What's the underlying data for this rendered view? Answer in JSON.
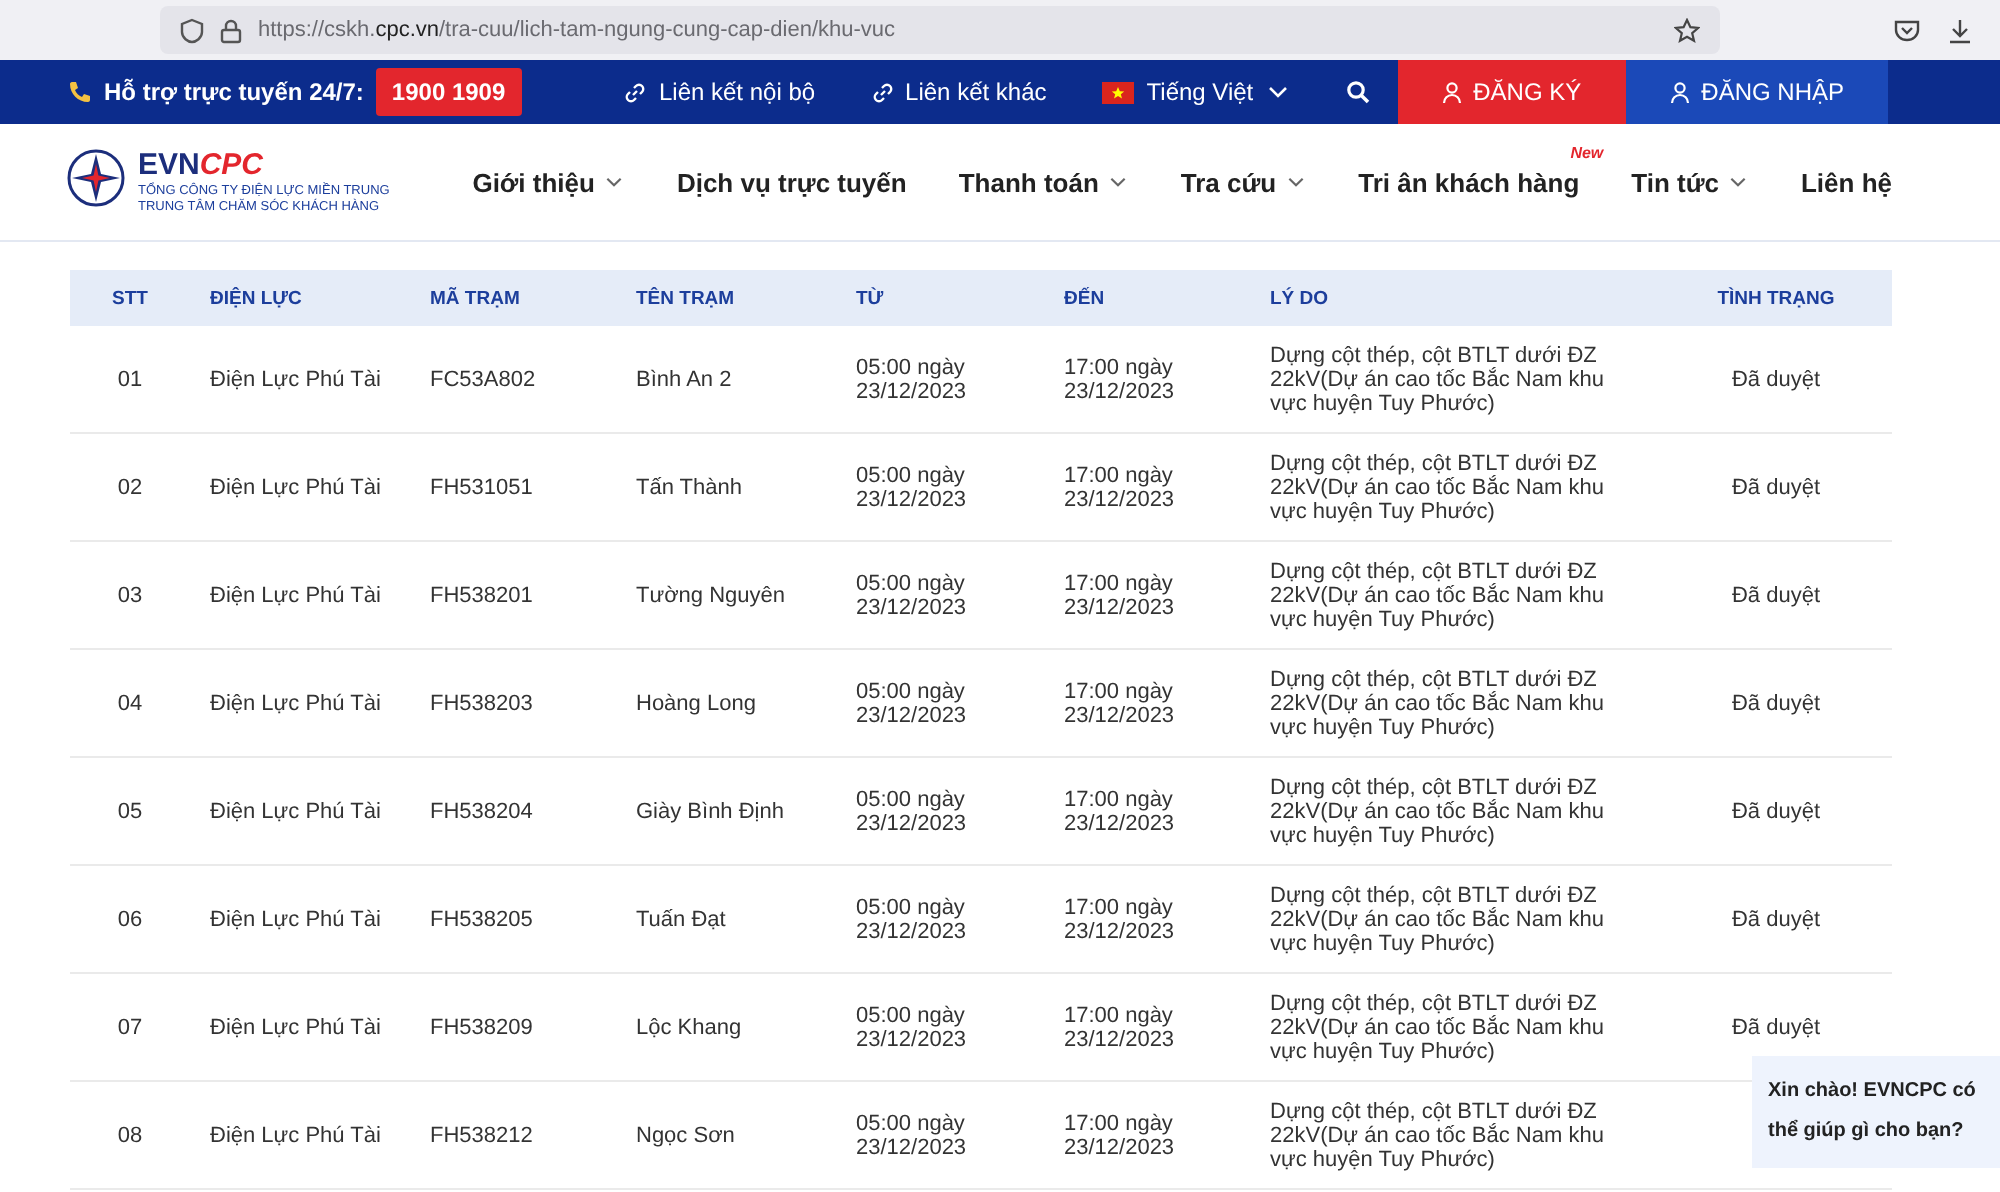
{
  "browser": {
    "url": "https://cskh.**cpc.vn**/tra-cuu/lich-tam-ngung-cung-cap-dien/khu-vuc"
  },
  "topbar": {
    "support_label": "Hỗ trợ trực tuyến 24/7:",
    "hotline": "1900 1909",
    "links": [
      "Liên kết nội bộ",
      "Liên kết khác"
    ],
    "language": "Tiếng Việt",
    "register": "ĐĂNG KÝ",
    "login": "ĐĂNG NHẬP"
  },
  "logo": {
    "brand_a": "EVN",
    "brand_b": "CPC",
    "line1": "TỔNG CÔNG TY ĐIỆN LỰC MIỀN TRUNG",
    "line2": "TRUNG TÂM CHĂM SÓC KHÁCH HÀNG"
  },
  "nav": [
    {
      "label": "Giới thiệu",
      "dropdown": true
    },
    {
      "label": "Dịch vụ trực tuyến",
      "dropdown": false
    },
    {
      "label": "Thanh toán",
      "dropdown": true
    },
    {
      "label": "Tra cứu",
      "dropdown": true
    },
    {
      "label": "Tri ân khách hàng",
      "dropdown": false,
      "badge": "New"
    },
    {
      "label": "Tin tức",
      "dropdown": true
    },
    {
      "label": "Liên hệ",
      "dropdown": false
    }
  ],
  "table": {
    "columns": [
      "STT",
      "ĐIỆN LỰC",
      "MÃ TRẠM",
      "TÊN TRẠM",
      "TỪ",
      "ĐẾN",
      "LÝ DO",
      "TÌNH TRẠNG"
    ],
    "rows": [
      [
        "01",
        "Điện Lực Phú Tài",
        "FC53A802",
        "Bình An 2",
        "05:00 ngày 23/12/2023",
        "17:00 ngày 23/12/2023",
        "Dựng cột thép, cột BTLT dưới ĐZ 22kV(Dự án cao tốc Bắc Nam khu vực huyện Tuy Phước)",
        "Đã duyệt"
      ],
      [
        "02",
        "Điện Lực Phú Tài",
        "FH531051",
        "Tấn Thành",
        "05:00 ngày 23/12/2023",
        "17:00 ngày 23/12/2023",
        "Dựng cột thép, cột BTLT dưới ĐZ 22kV(Dự án cao tốc Bắc Nam khu vực huyện Tuy Phước)",
        "Đã duyệt"
      ],
      [
        "03",
        "Điện Lực Phú Tài",
        "FH538201",
        "Tường Nguyên",
        "05:00 ngày 23/12/2023",
        "17:00 ngày 23/12/2023",
        "Dựng cột thép, cột BTLT dưới ĐZ 22kV(Dự án cao tốc Bắc Nam khu vực huyện Tuy Phước)",
        "Đã duyệt"
      ],
      [
        "04",
        "Điện Lực Phú Tài",
        "FH538203",
        "Hoàng Long",
        "05:00 ngày 23/12/2023",
        "17:00 ngày 23/12/2023",
        "Dựng cột thép, cột BTLT dưới ĐZ 22kV(Dự án cao tốc Bắc Nam khu vực huyện Tuy Phước)",
        "Đã duyệt"
      ],
      [
        "05",
        "Điện Lực Phú Tài",
        "FH538204",
        "Giày Bình Định",
        "05:00 ngày 23/12/2023",
        "17:00 ngày 23/12/2023",
        "Dựng cột thép, cột BTLT dưới ĐZ 22kV(Dự án cao tốc Bắc Nam khu vực huyện Tuy Phước)",
        "Đã duyệt"
      ],
      [
        "06",
        "Điện Lực Phú Tài",
        "FH538205",
        "Tuấn Đạt",
        "05:00 ngày 23/12/2023",
        "17:00 ngày 23/12/2023",
        "Dựng cột thép, cột BTLT dưới ĐZ 22kV(Dự án cao tốc Bắc Nam khu vực huyện Tuy Phước)",
        "Đã duyệt"
      ],
      [
        "07",
        "Điện Lực Phú Tài",
        "FH538209",
        "Lộc Khang",
        "05:00 ngày 23/12/2023",
        "17:00 ngày 23/12/2023",
        "Dựng cột thép, cột BTLT dưới ĐZ 22kV(Dự án cao tốc Bắc Nam khu vực huyện Tuy Phước)",
        "Đã duyệt"
      ],
      [
        "08",
        "Điện Lực Phú Tài",
        "FH538212",
        "Ngọc Sơn",
        "05:00 ngày 23/12/2023",
        "17:00 ngày 23/12/2023",
        "Dựng cột thép, cột BTLT dưới ĐZ 22kV(Dự án cao tốc Bắc Nam khu vực huyện Tuy Phước)"
      ]
    ]
  },
  "chat_bubble": "Xin chào! EVNCPC có thể giúp gì cho bạn?"
}
